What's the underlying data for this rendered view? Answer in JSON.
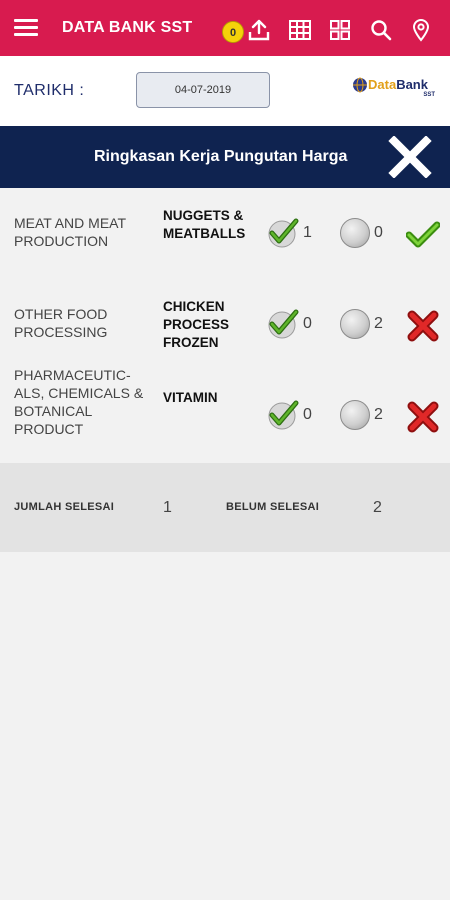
{
  "app": {
    "title": "DATA BANK SST",
    "badge_count": "0",
    "icons": [
      "menu-icon",
      "upload-icon",
      "table-icon",
      "grid-icon",
      "search-icon",
      "location-pin-icon"
    ],
    "brand_color": "#d81b4f"
  },
  "date": {
    "label": "TARIKH :",
    "value": "04-07-2019"
  },
  "logo": {
    "text_data": "Data",
    "text_bank": "Bank",
    "sub": "SST"
  },
  "header": {
    "title": "Ringkasan Kerja Pungutan Harga",
    "band_color": "#0f2350"
  },
  "rows": [
    {
      "category": "MEAT AND MEAT PRODUCTION",
      "item": "NUGGETS & MEATBALLS",
      "done": "1",
      "pending": "0",
      "status": "complete-icon"
    },
    {
      "category": "OTHER FOOD PROCESSING",
      "item": "CHICKEN PROCESS FROZEN",
      "done": "0",
      "pending": "2",
      "status": "incomplete-icon"
    },
    {
      "category": "PHARMACEUTIC-ALS, CHEMICALS & BOTANICAL PRODUCT",
      "item": "VITAMIN",
      "done": "0",
      "pending": "2",
      "status": "incomplete-icon"
    }
  ],
  "summary": {
    "done_label": "JUMLAH SELESAI",
    "done_value": "1",
    "pending_label": "BELUM SELESAI",
    "pending_value": "2"
  }
}
